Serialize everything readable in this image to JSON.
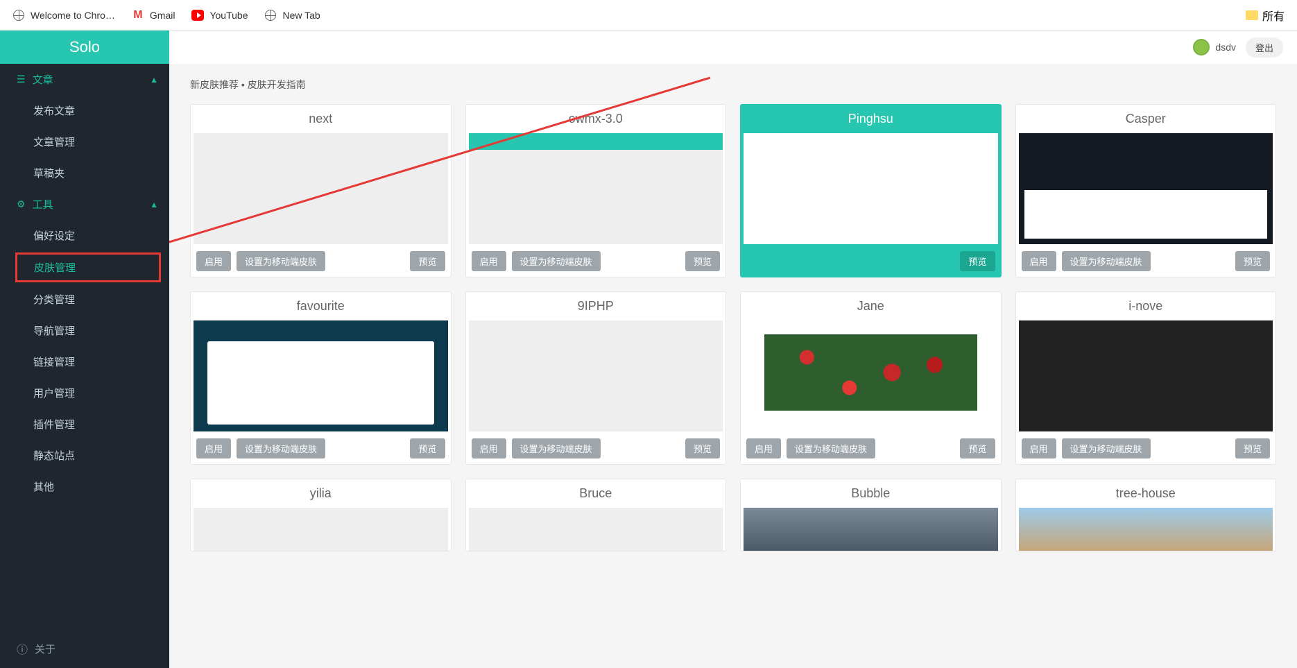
{
  "bookmarks": [
    {
      "label": "Welcome to Chro…",
      "icon": "globe"
    },
    {
      "label": "Gmail",
      "icon": "gmail"
    },
    {
      "label": "YouTube",
      "icon": "youtube"
    },
    {
      "label": "New Tab",
      "icon": "globe"
    }
  ],
  "bookmarks_right": "所有",
  "app": {
    "logo": "Solo"
  },
  "user": {
    "name": "dsdv",
    "logout": "登出"
  },
  "sidebar": {
    "groups": [
      {
        "icon": "list",
        "label": "文章",
        "chevron": "▲",
        "items": [
          {
            "label": "发布文章"
          },
          {
            "label": "文章管理"
          },
          {
            "label": "草稿夹"
          }
        ]
      },
      {
        "icon": "gear",
        "label": "工具",
        "chevron": "▲",
        "items": [
          {
            "label": "偏好设定"
          },
          {
            "label": "皮肤管理",
            "highlight": true
          },
          {
            "label": "分类管理"
          },
          {
            "label": "导航管理"
          },
          {
            "label": "链接管理"
          },
          {
            "label": "用户管理"
          },
          {
            "label": "插件管理"
          },
          {
            "label": "静态站点"
          },
          {
            "label": "其他"
          }
        ]
      }
    ],
    "footer": {
      "label": "关于"
    }
  },
  "breadcrumb": {
    "link1": "新皮肤推荐",
    "sep": " • ",
    "link2": "皮肤开发指南"
  },
  "buttons": {
    "enable": "启用",
    "mobile": "设置为移动端皮肤",
    "preview": "预览"
  },
  "skins": [
    {
      "name": "next",
      "thumb": "plain",
      "active": false,
      "short": false
    },
    {
      "name": "owmx-3.0",
      "thumb": "tealtop",
      "active": false,
      "short": false
    },
    {
      "name": "Pinghsu",
      "thumb": "panda",
      "active": true,
      "short": false
    },
    {
      "name": "Casper",
      "thumb": "casper",
      "active": false,
      "short": false
    },
    {
      "name": "favourite",
      "thumb": "fav",
      "active": false,
      "short": false
    },
    {
      "name": "9IPHP",
      "thumb": "plain",
      "active": false,
      "short": false
    },
    {
      "name": "Jane",
      "thumb": "flowers",
      "active": false,
      "short": false
    },
    {
      "name": "i-nove",
      "thumb": "dark",
      "active": false,
      "short": false
    },
    {
      "name": "yilia",
      "thumb": "plain",
      "active": false,
      "short": true
    },
    {
      "name": "Bruce",
      "thumb": "plain",
      "active": false,
      "short": true
    },
    {
      "name": "Bubble",
      "thumb": "bubble",
      "active": false,
      "short": true
    },
    {
      "name": "tree-house",
      "thumb": "tree",
      "active": false,
      "short": true
    }
  ]
}
